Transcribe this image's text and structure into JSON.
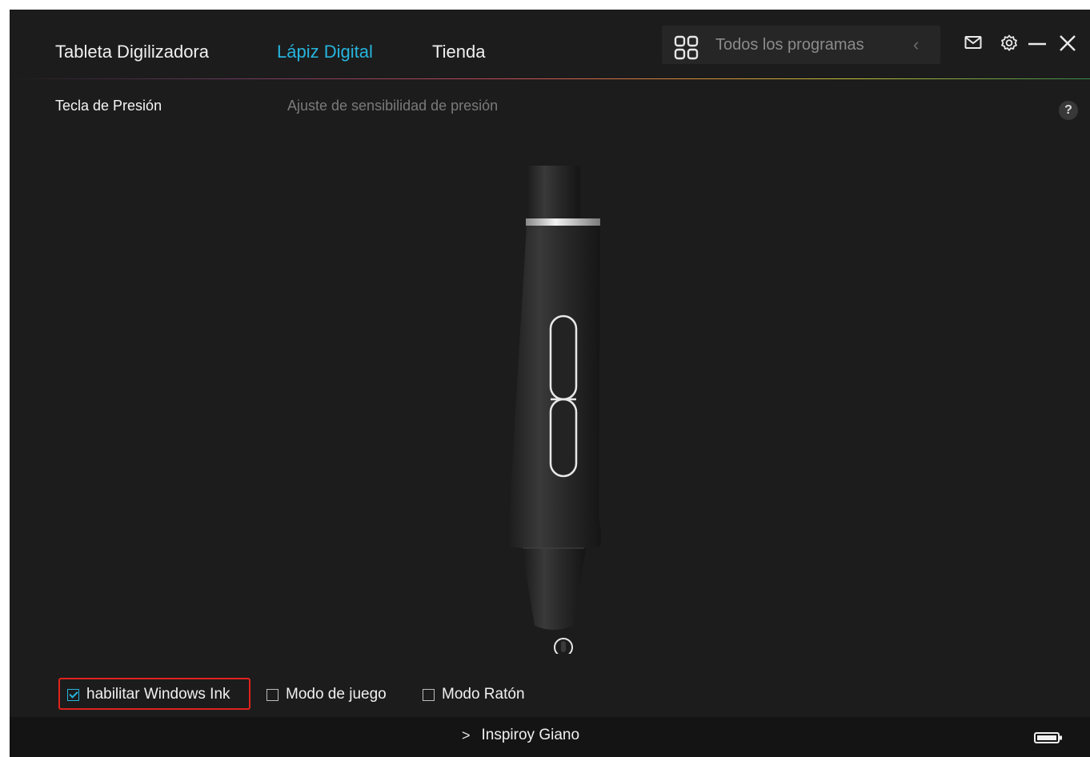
{
  "nav": {
    "tabs": [
      {
        "label": "Tableta Digilizadora",
        "active": false
      },
      {
        "label": "Lápiz Digital",
        "active": true
      },
      {
        "label": "Tienda",
        "active": false
      }
    ],
    "program_selector": {
      "label": "Todos los programas",
      "icon": "app-grid-icon"
    },
    "window_icons": [
      "mail-icon",
      "gear-icon",
      "minimize-icon",
      "close-icon"
    ]
  },
  "section": {
    "title": "Tecla de Presión",
    "pressure_link": "Ajuste de sensibilidad de presión",
    "help": "?"
  },
  "options": [
    {
      "label": "habilitar Windows Ink",
      "checked": true
    },
    {
      "label": "Modo de juego",
      "checked": false
    },
    {
      "label": "Modo Ratón",
      "checked": false
    }
  ],
  "footer": {
    "device": "Inspiroy Giano",
    "battery_icon": "battery-icon"
  },
  "colors": {
    "accent": "#27b4dd",
    "background": "#1c1c1c",
    "highlight": "#e0231d"
  }
}
